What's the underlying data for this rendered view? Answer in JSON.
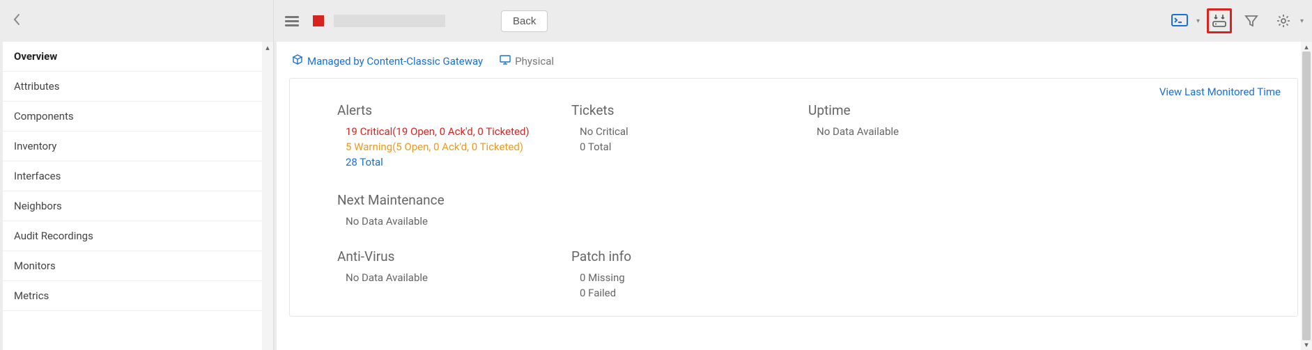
{
  "sidebar": {
    "items": [
      {
        "label": "Overview",
        "active": true
      },
      {
        "label": "Attributes"
      },
      {
        "label": "Components"
      },
      {
        "label": "Inventory"
      },
      {
        "label": "Interfaces"
      },
      {
        "label": "Neighbors"
      },
      {
        "label": "Audit Recordings"
      },
      {
        "label": "Monitors"
      },
      {
        "label": "Metrics"
      }
    ]
  },
  "toolbar": {
    "back_label": "Back"
  },
  "breadcrumb": {
    "managed_by": "Managed by Content-Classic Gateway",
    "physical": "Physical"
  },
  "panel": {
    "view_last_monitored": "View Last Monitored Time",
    "alerts": {
      "title": "Alerts",
      "critical": "19 Critical(19 Open, 0 Ack'd, 0 Ticketed)",
      "warning": "5 Warning(5 Open, 0 Ack'd, 0 Ticketed)",
      "total": "28 Total"
    },
    "tickets": {
      "title": "Tickets",
      "no_critical": "No Critical",
      "total": "0 Total"
    },
    "uptime": {
      "title": "Uptime",
      "body": "No Data Available"
    },
    "next_maint": {
      "title": "Next Maintenance",
      "body": "No Data Available"
    },
    "antivirus": {
      "title": "Anti-Virus",
      "body": "No Data Available"
    },
    "patch": {
      "title": "Patch info",
      "missing": "0 Missing",
      "failed": "0 Failed"
    }
  }
}
